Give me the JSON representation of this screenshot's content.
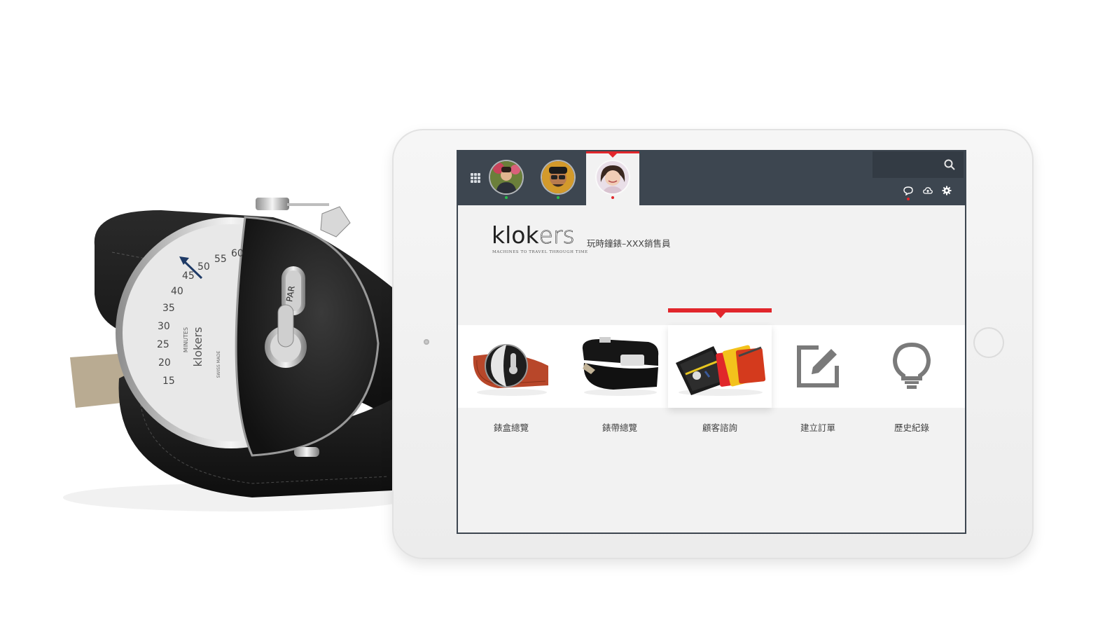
{
  "topbar": {
    "apps_icon": "grid-apps-icon",
    "tabs": [
      {
        "name": "user-1",
        "status_color": "#27c04a",
        "active": false
      },
      {
        "name": "user-2",
        "status_color": "#27c04a",
        "active": false
      },
      {
        "name": "user-3",
        "status_color": "#e1262b",
        "active": true
      }
    ],
    "search": {
      "placeholder": "",
      "icon": "search-icon"
    },
    "tools": [
      "chat-icon",
      "cloud-upload-icon",
      "gear-icon"
    ],
    "accent_color": "#e1262b",
    "bar_color": "#3d4650"
  },
  "brand": {
    "logo_main": "klok",
    "logo_suffix": "ers",
    "tagline": "MACHINES TO TRAVEL THROUGH TIME",
    "subtitle": "玩時鐘錶–XXX銷售員"
  },
  "menu": [
    {
      "label": "錶盒總覽",
      "icon": "watch-case-image",
      "active": false
    },
    {
      "label": "錶帶總覽",
      "icon": "watch-strap-image",
      "active": false
    },
    {
      "label": "顧客諮詢",
      "icon": "travel-case-image",
      "active": true
    },
    {
      "label": "建立訂單",
      "icon": "edit-order-icon",
      "active": false
    },
    {
      "label": "歷史紀錄",
      "icon": "lightbulb-icon",
      "active": false
    }
  ],
  "hero": {
    "watch_text": {
      "brand": "klokers",
      "button": "PAR",
      "minutes": "MINUTES",
      "swiss": "SWISS MADE",
      "numbers": [
        "50",
        "55",
        "60",
        "45",
        "40",
        "35",
        "30",
        "25",
        "20",
        "15"
      ]
    }
  }
}
